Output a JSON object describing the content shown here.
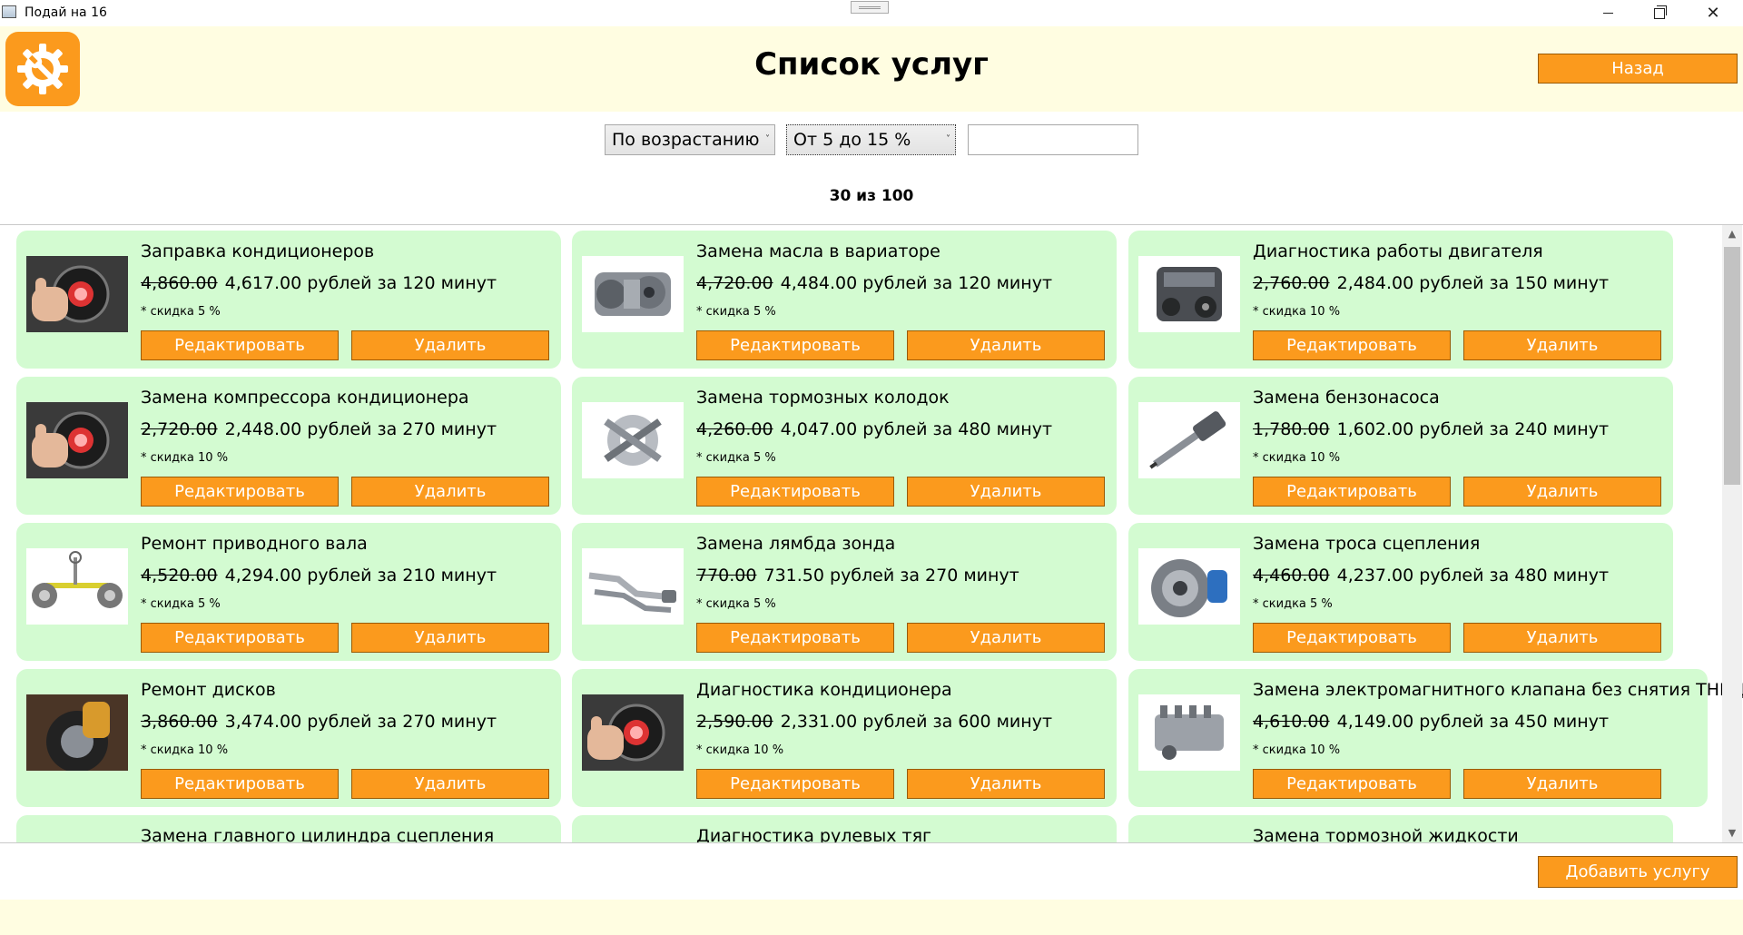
{
  "window": {
    "title": "Подай на 16"
  },
  "header": {
    "title": "Список услуг",
    "back_label": "Назад",
    "logo_icon": "gear-wrench-icon"
  },
  "filters": {
    "sort_selected": "По возрастанию",
    "discount_selected": "От 5 до 15 %",
    "search_value": ""
  },
  "counter": "30 из 100",
  "add_label": "Добавить услугу",
  "colors": {
    "accent": "#fb9a1d",
    "card": "#d3fbd1",
    "header": "#fffde1"
  },
  "services": [
    {
      "name": "Заправка кондиционеров",
      "old_price": "4,860.00",
      "new_price": "4,617.00 рублей за 120 минут",
      "discount": "* скидка 5 %",
      "edit": "Редактировать",
      "delete": "Удалить",
      "image": "gauge"
    },
    {
      "name": "Замена масла в вариаторе",
      "old_price": "4,720.00",
      "new_price": "4,484.00 рублей за 120 минут",
      "discount": "* скидка 5 %",
      "edit": "Редактировать",
      "delete": "Удалить",
      "image": "gearbox"
    },
    {
      "name": "Диагностика работы двигателя",
      "old_price": "2,760.00",
      "new_price": "2,484.00 рублей за 150 минут",
      "discount": "* скидка 10 %",
      "edit": "Редактировать",
      "delete": "Удалить",
      "image": "engine"
    },
    {
      "name": "Замена компрессора кондиционера",
      "old_price": "2,720.00",
      "new_price": "2,448.00 рублей за 270 минут",
      "discount": "* скидка 10 %",
      "edit": "Редактировать",
      "delete": "Удалить",
      "image": "gauge"
    },
    {
      "name": "Замена тормозных колодок",
      "old_price": "4,260.00",
      "new_price": "4,047.00 рублей за 480 минут",
      "discount": "* скидка 5 %",
      "edit": "Редактировать",
      "delete": "Удалить",
      "image": "tools"
    },
    {
      "name": "Замена бензонасоса",
      "old_price": "1,780.00",
      "new_price": "1,602.00 рублей за 240 минут",
      "discount": "* скидка 10 %",
      "edit": "Редактировать",
      "delete": "Удалить",
      "image": "injector"
    },
    {
      "name": "Ремонт приводного вала",
      "old_price": "4,520.00",
      "new_price": "4,294.00 рублей за 210 минут",
      "discount": "* скидка 5 %",
      "edit": "Редактировать",
      "delete": "Удалить",
      "image": "chassis"
    },
    {
      "name": "Замена лямбда зонда",
      "old_price": "770.00",
      "new_price": "731.50 рублей за 270 минут",
      "discount": "* скидка 5 %",
      "edit": "Редактировать",
      "delete": "Удалить",
      "image": "exhaust"
    },
    {
      "name": "Замена троса сцепления",
      "old_price": "4,460.00",
      "new_price": "4,237.00 рублей за 480 минут",
      "discount": "* скидка 5 %",
      "edit": "Редактировать",
      "delete": "Удалить",
      "image": "clutch"
    },
    {
      "name": "Ремонт дисков",
      "old_price": "3,860.00",
      "new_price": "3,474.00 рублей за 270 минут",
      "discount": "* скидка 10 %",
      "edit": "Редактировать",
      "delete": "Удалить",
      "image": "wheel"
    },
    {
      "name": "Диагностика кондиционера",
      "old_price": "2,590.00",
      "new_price": "2,331.00 рублей за 600 минут",
      "discount": "* скидка 10 %",
      "edit": "Редактировать",
      "delete": "Удалить",
      "image": "gauge"
    },
    {
      "name": "Замена электромагнитного клапана без снятия ТНВД",
      "old_price": "4,610.00",
      "new_price": "4,149.00 рублей за 450 минут",
      "discount": "* скидка 10 %",
      "edit": "Редактировать",
      "delete": "Удалить",
      "image": "pump"
    },
    {
      "name": "Замена главного цилиндра сцепления",
      "old_price": "",
      "new_price": "",
      "discount": "",
      "edit": "",
      "delete": "",
      "image": ""
    },
    {
      "name": "Диагностика рулевых тяг",
      "old_price": "",
      "new_price": "",
      "discount": "",
      "edit": "",
      "delete": "",
      "image": ""
    },
    {
      "name": "Замена тормозной жидкости",
      "old_price": "",
      "new_price": "",
      "discount": "",
      "edit": "",
      "delete": "",
      "image": ""
    }
  ]
}
